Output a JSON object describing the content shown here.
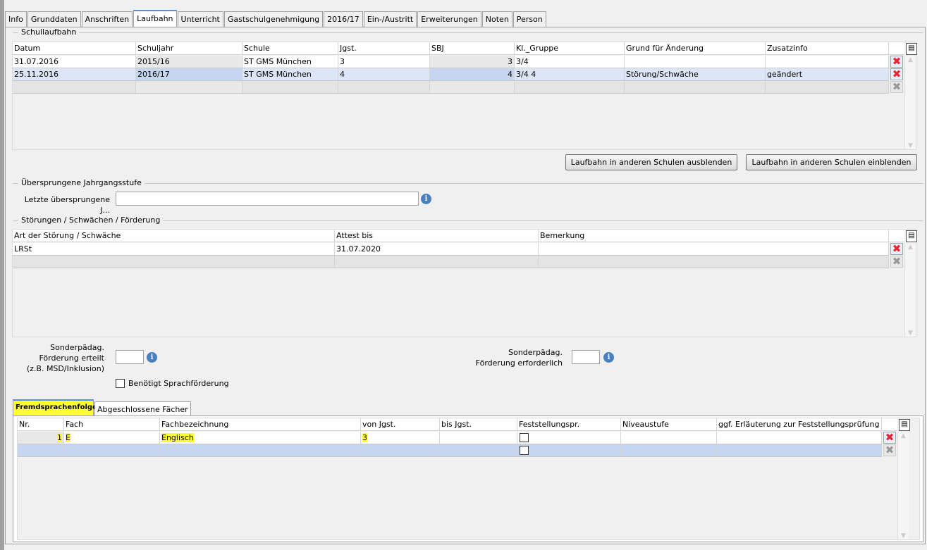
{
  "tabs": [
    "Info",
    "Grunddaten",
    "Anschriften",
    "Laufbahn",
    "Unterricht",
    "Gastschulgenehmigung",
    "2016/17",
    "Ein-/Austritt",
    "Erweiterungen",
    "Noten",
    "Person"
  ],
  "active_tab": "Laufbahn",
  "schullaufbahn": {
    "title": "Schullaufbahn",
    "columns": [
      "Datum",
      "Schuljahr",
      "Schule",
      "Jgst.",
      "SBJ",
      "Kl._Gruppe",
      "Grund für Änderung",
      "Zusatzinfo"
    ],
    "sorted_column": "Datum",
    "rows": [
      [
        "31.07.2016",
        "2015/16",
        "ST GMS München",
        "3",
        "3",
        "3/4",
        "",
        ""
      ],
      [
        "25.11.2016",
        "2016/17",
        "ST GMS München",
        "4",
        "4",
        "3/4 4",
        "Störung/Schwäche",
        "geändert"
      ]
    ],
    "btn_hide": "Laufbahn in anderen Schulen ausblenden",
    "btn_show": "Laufbahn in anderen Schulen einblenden"
  },
  "skipped": {
    "title": "Übersprungene Jahrgangsstufe",
    "label": "Letzte übersprungene J...",
    "value": ""
  },
  "stoerungen": {
    "title": "Störungen / Schwächen / Förderung",
    "columns": [
      "Art der Störung / Schwäche",
      "Attest bis",
      "Bemerkung"
    ],
    "rows": [
      [
        "LRSt",
        "31.07.2020",
        ""
      ]
    ]
  },
  "foerderung": {
    "erteilt_label": "Sonderpädag. Förderung erteilt (z.B. MSD/Inklusion)",
    "erteilt_l1": "Sonderpädag.",
    "erteilt_l2": "Förderung erteilt",
    "erteilt_l3": "(z.B. MSD/Inklusion)",
    "erforderlich_l1": "Sonderpädag.",
    "erforderlich_l2": "Förderung erforderlich",
    "sprach_label": "Benötigt Sprachförderung",
    "sprach_checked": false
  },
  "subtabs": [
    "Fremdsprachenfolge",
    "Abgeschlossene Fächer"
  ],
  "active_subtab": "Fremdsprachenfolge",
  "fremdsprachen": {
    "columns": [
      "Nr.",
      "Fach",
      "Fachbezeichnung",
      "von Jgst.",
      "bis Jgst.",
      "Feststellungspr.",
      "Niveaustufe",
      "ggf. Erläuterung zur Feststellungsprüfung"
    ],
    "rows": [
      [
        "1",
        "E",
        "Englisch",
        "3",
        "",
        "",
        "",
        ""
      ]
    ]
  },
  "colors": {
    "highlight": "#ffff33",
    "selected_row": "#c7d6f0",
    "delete": "#e02030"
  }
}
